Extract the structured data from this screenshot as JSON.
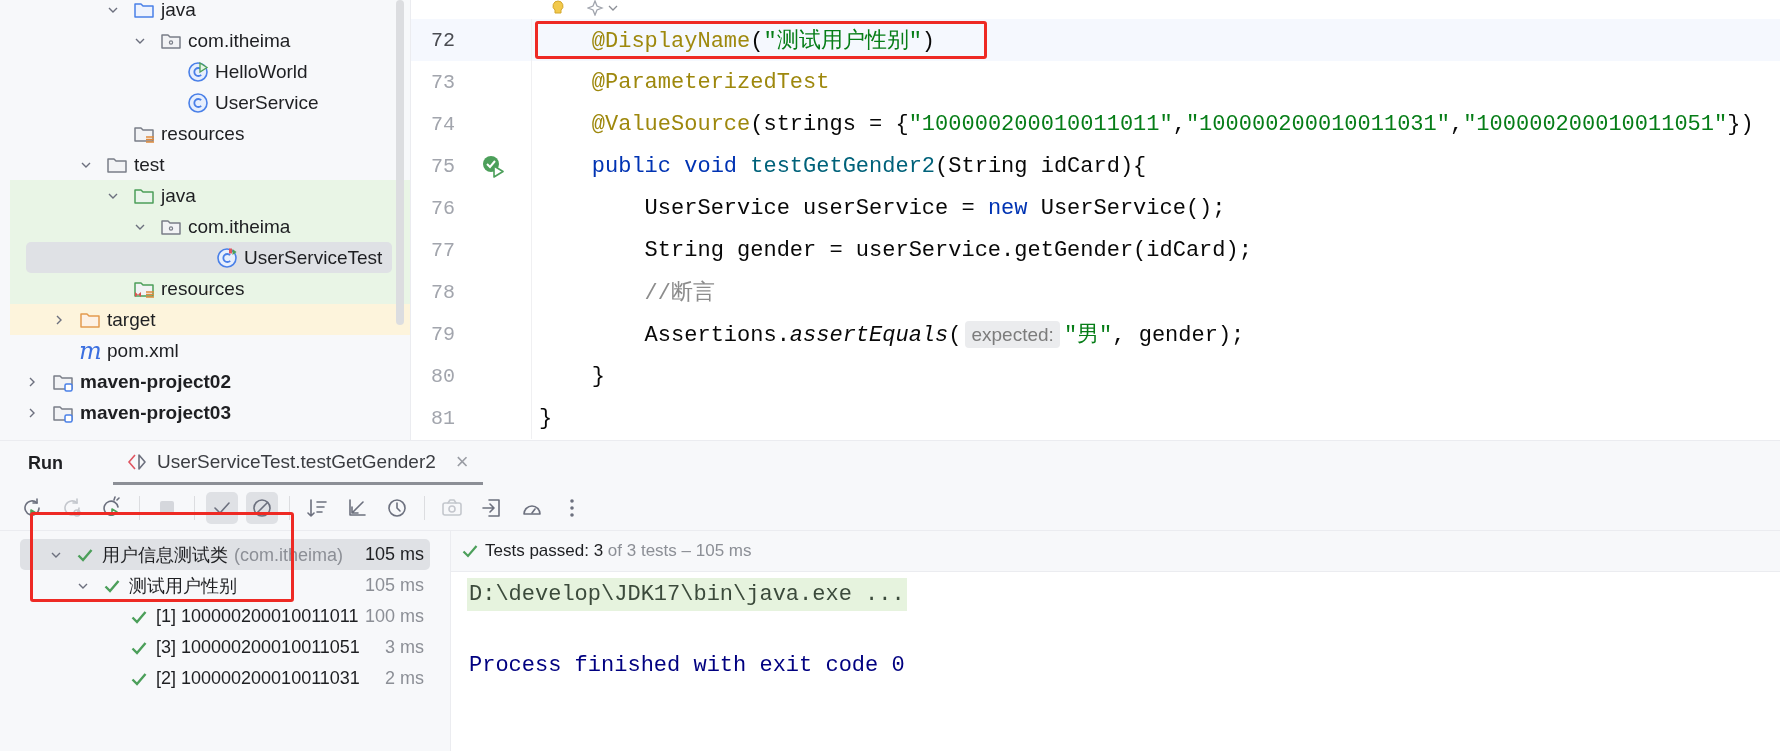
{
  "project_tree": [
    {
      "children": [
        {
          "children": [
            {
              "children": [
                {
                  "label": "java",
                  "kind": "source-folder",
                  "test_scope": false,
                  "expanded": true,
                  "selected": false,
                  "children": [
                    {
                      "label": "com.itheima",
                      "kind": "package",
                      "test_scope": false,
                      "expanded": true,
                      "selected": false,
                      "children": [
                        {
                          "label": "HelloWorld",
                          "kind": "runnable-class",
                          "test_scope": false,
                          "selected": false
                        },
                        {
                          "label": "UserService",
                          "kind": "class",
                          "test_scope": false,
                          "selected": false
                        }
                      ]
                    }
                  ]
                },
                {
                  "label": "resources",
                  "kind": "resources-folder",
                  "test_scope": false,
                  "selected": false
                }
              ]
            },
            {
              "label": "test",
              "kind": "folder",
              "test_scope": false,
              "expanded": true,
              "selected": false,
              "children": [
                {
                  "label": "java",
                  "kind": "test-folder",
                  "test_scope": true,
                  "expanded": true,
                  "selected": false,
                  "children": [
                    {
                      "label": "com.itheima",
                      "kind": "package",
                      "test_scope": true,
                      "expanded": true,
                      "selected": false,
                      "children": [
                        {
                          "label": "UserServiceTest",
                          "kind": "test-class",
                          "test_scope": true,
                          "selected": true
                        }
                      ]
                    }
                  ]
                },
                {
                  "label": "resources",
                  "kind": "test-resources-folder",
                  "test_scope": true,
                  "selected": false
                }
              ]
            }
          ]
        },
        {
          "label": "target",
          "kind": "excluded-folder",
          "test_scope": false,
          "expanded": false,
          "selected": false
        },
        {
          "label": "pom.xml",
          "kind": "maven-file",
          "glyph": "m",
          "test_scope": false,
          "selected": false
        }
      ]
    },
    {
      "label": "maven-project02",
      "kind": "module",
      "test_scope": false,
      "expanded": false,
      "selected": false
    },
    {
      "label": "maven-project03",
      "kind": "module",
      "test_scope": false,
      "expanded": false,
      "selected": false
    }
  ],
  "editor": {
    "lines": [
      {
        "number": "72",
        "current": true,
        "highlighted": true,
        "run_marker": false,
        "tokens": [
          {
            "kind": "annotation",
            "text": "    @DisplayName"
          },
          {
            "kind": "plain",
            "text": "("
          },
          {
            "kind": "string",
            "text": "\"测试用户性别\""
          },
          {
            "kind": "plain",
            "text": ")"
          }
        ]
      },
      {
        "number": "73",
        "current": false,
        "highlighted": false,
        "run_marker": false,
        "tokens": [
          {
            "kind": "annotation",
            "text": "    @ParameterizedTest"
          }
        ]
      },
      {
        "number": "74",
        "current": false,
        "highlighted": false,
        "run_marker": false,
        "tokens": [
          {
            "kind": "annotation",
            "text": "    @ValueSource"
          },
          {
            "kind": "plain",
            "text": "(strings = {"
          },
          {
            "kind": "string",
            "text": "\"100000200010011011\""
          },
          {
            "kind": "plain",
            "text": ","
          },
          {
            "kind": "string",
            "text": "\"100000200010011031\""
          },
          {
            "kind": "plain",
            "text": ","
          },
          {
            "kind": "string",
            "text": "\"100000200010011051\""
          },
          {
            "kind": "plain",
            "text": "})"
          }
        ]
      },
      {
        "number": "75",
        "current": false,
        "highlighted": false,
        "run_marker": true,
        "tokens": [
          {
            "kind": "keyword",
            "text": "    public void "
          },
          {
            "kind": "method",
            "text": "testGetGender2"
          },
          {
            "kind": "plain",
            "text": "(String idCard){"
          }
        ]
      },
      {
        "number": "76",
        "current": false,
        "highlighted": false,
        "run_marker": false,
        "tokens": [
          {
            "kind": "plain",
            "text": "        UserService userService = "
          },
          {
            "kind": "keyword",
            "text": "new"
          },
          {
            "kind": "plain",
            "text": " UserService();"
          }
        ]
      },
      {
        "number": "77",
        "current": false,
        "highlighted": false,
        "run_marker": false,
        "tokens": [
          {
            "kind": "plain",
            "text": "        String gender = userService.getGender(idCard);"
          }
        ]
      },
      {
        "number": "78",
        "current": false,
        "highlighted": false,
        "run_marker": false,
        "tokens": [
          {
            "kind": "comment",
            "text": "        //断言"
          }
        ]
      },
      {
        "number": "79",
        "current": false,
        "highlighted": false,
        "run_marker": false,
        "tokens": [
          {
            "kind": "plain",
            "text": "        Assertions."
          },
          {
            "kind": "static",
            "text": "assertEquals"
          },
          {
            "kind": "plain",
            "text": "("
          },
          {
            "kind": "hint",
            "text": "expected:"
          },
          {
            "kind": "string",
            "text": "\"男\""
          },
          {
            "kind": "plain",
            "text": ", gender);"
          }
        ]
      },
      {
        "number": "80",
        "current": false,
        "highlighted": false,
        "run_marker": false,
        "tokens": [
          {
            "kind": "plain",
            "text": "    }"
          }
        ]
      },
      {
        "number": "81",
        "current": false,
        "highlighted": false,
        "run_marker": false,
        "tokens": [
          {
            "kind": "plain",
            "text": "}"
          }
        ]
      }
    ]
  },
  "run_panel": {
    "title": "Run",
    "tab": {
      "label": "UserServiceTest.testGetGender2",
      "close": "×",
      "selected": true
    },
    "toolbar": [
      {
        "kind": "rerun",
        "disabled": false,
        "toggled": false
      },
      {
        "kind": "rerun-failed",
        "disabled": true,
        "toggled": false
      },
      {
        "kind": "auto-rerun",
        "disabled": false,
        "toggled": false
      },
      {
        "kind": "stop",
        "disabled": true,
        "toggled": false
      },
      {
        "kind": "show-passed",
        "disabled": false,
        "toggled": true
      },
      {
        "kind": "show-ignored",
        "disabled": false,
        "toggled": true
      },
      {
        "kind": "sort",
        "disabled": false,
        "toggled": false
      },
      {
        "kind": "collapse",
        "disabled": false,
        "toggled": false
      },
      {
        "kind": "history",
        "disabled": false,
        "toggled": false
      },
      {
        "kind": "camera",
        "disabled": true,
        "toggled": false
      },
      {
        "kind": "import",
        "disabled": false,
        "toggled": false
      },
      {
        "kind": "gauge",
        "disabled": false,
        "toggled": false
      },
      {
        "kind": "more",
        "disabled": false,
        "toggled": false
      }
    ],
    "tests": [
      {
        "label": "用户信息测试类",
        "package": "(com.itheima)",
        "time": "105 ms",
        "passed": true,
        "expanded": true,
        "selected": true,
        "children": [
          {
            "label": "测试用户性别",
            "time": "105 ms",
            "passed": true,
            "expanded": true,
            "selected": false,
            "children": [
              {
                "label": "[1] 100000200010011011",
                "time": "100 ms",
                "passed": true,
                "selected": false
              },
              {
                "label": "[3] 100000200010011051",
                "time": "3 ms",
                "passed": true,
                "selected": false
              },
              {
                "label": "[2] 100000200010011031",
                "time": "2 ms",
                "passed": true,
                "selected": false
              }
            ]
          }
        ]
      }
    ],
    "summary": {
      "passed": true,
      "count": "Tests passed: 3",
      "detail": "of 3 tests – 105 ms"
    },
    "console": [
      {
        "kind": "command",
        "text": "D:\\develop\\JDK17\\bin\\java.exe ..."
      },
      {
        "kind": "exit",
        "text": "Process finished with exit code 0"
      }
    ]
  }
}
